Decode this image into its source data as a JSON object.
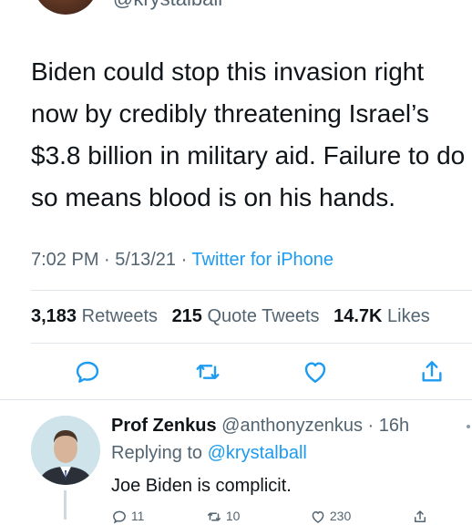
{
  "original_tweet": {
    "handle": "@krystalball",
    "text": "Biden could stop this invasion right now by credibly threatening Israel’s $3.8 billion in military aid. Failure to do so means blood is on his hands.",
    "time": "7:02 PM",
    "date": "5/13/21",
    "source": "Twitter for iPhone",
    "stats": {
      "retweets_count": "3,183",
      "retweets_label": "Retweets",
      "quotes_count": "215",
      "quotes_label": "Quote Tweets",
      "likes_count": "14.7K",
      "likes_label": "Likes"
    },
    "actions": [
      "reply-icon",
      "retweet-icon",
      "like-icon",
      "share-icon"
    ]
  },
  "reply": {
    "name": "Prof Zenkus",
    "handle": "@anthonyzenkus",
    "age": "16h",
    "replying_label": "Replying to",
    "replying_handle": "@krystalball",
    "text": "Joe Biden is complicit.",
    "counts": {
      "replies": "11",
      "retweets": "10",
      "likes": "230"
    }
  },
  "colors": {
    "link": "#1d9bf0",
    "secondary_text": "#536471",
    "primary_text": "#0f1419"
  }
}
